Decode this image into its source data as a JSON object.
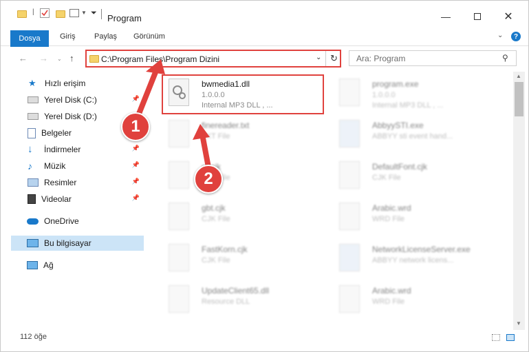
{
  "window": {
    "title": "Program"
  },
  "ribbon": {
    "tabs": [
      "Dosya",
      "Giriş",
      "Paylaş",
      "Görünüm"
    ]
  },
  "address": {
    "path": "C:\\Program Files\\Program Dizini",
    "refresh_icon": "refresh-icon"
  },
  "search": {
    "placeholder": "Ara: Program"
  },
  "sidebar": {
    "items": [
      {
        "label": "Hızlı erişim",
        "icon": "star-icon"
      },
      {
        "label": "Yerel Disk (C:)",
        "icon": "drive-icon"
      },
      {
        "label": "Yerel Disk (D:)",
        "icon": "drive-icon"
      },
      {
        "label": "Belgeler",
        "icon": "document-icon"
      },
      {
        "label": "İndirmeler",
        "icon": "download-icon"
      },
      {
        "label": "Müzik",
        "icon": "music-icon"
      },
      {
        "label": "Resimler",
        "icon": "pictures-icon"
      },
      {
        "label": "Videolar",
        "icon": "video-icon"
      },
      {
        "label": "OneDrive",
        "icon": "cloud-icon"
      },
      {
        "label": "Bu bilgisayar",
        "icon": "computer-icon"
      },
      {
        "label": "Ağ",
        "icon": "network-icon"
      }
    ]
  },
  "files": [
    {
      "name": "bwmedia1.dll",
      "line2": "1.0.0.0",
      "line3": "Internal MP3 DLL , ..."
    },
    {
      "name": "program.exe",
      "line2": "1.0.0.0",
      "line3": "Internal MP3 DLL , ..."
    },
    {
      "name": "finereader.txt",
      "line2": "TXT File",
      "line3": ""
    },
    {
      "name": "AbbyySTI.exe",
      "line2": "ABBYY sti event hand...",
      "line3": ""
    },
    {
      "name": "ot.cjk",
      "line2": "CJK File",
      "line3": ""
    },
    {
      "name": "DefaultFont.cjk",
      "line2": "CJK File",
      "line3": ""
    },
    {
      "name": "gbt.cjk",
      "line2": "CJK File",
      "line3": ""
    },
    {
      "name": "Arabic.wrd",
      "line2": "WRD File",
      "line3": ""
    },
    {
      "name": "FastKorn.cjk",
      "line2": "CJK File",
      "line3": ""
    },
    {
      "name": "NetworkLicenseServer.exe",
      "line2": "ABBYY network licens...",
      "line3": ""
    },
    {
      "name": "UpdateClient65.dll",
      "line2": "Resource DLL",
      "line3": ""
    },
    {
      "name": "Arabic.wrd",
      "line2": "WRD File",
      "line3": ""
    }
  ],
  "status": {
    "text": "112 öğe"
  },
  "annotations": {
    "one": "1",
    "two": "2"
  },
  "colors": {
    "accent": "#1979ca",
    "highlight": "#e0413d"
  }
}
